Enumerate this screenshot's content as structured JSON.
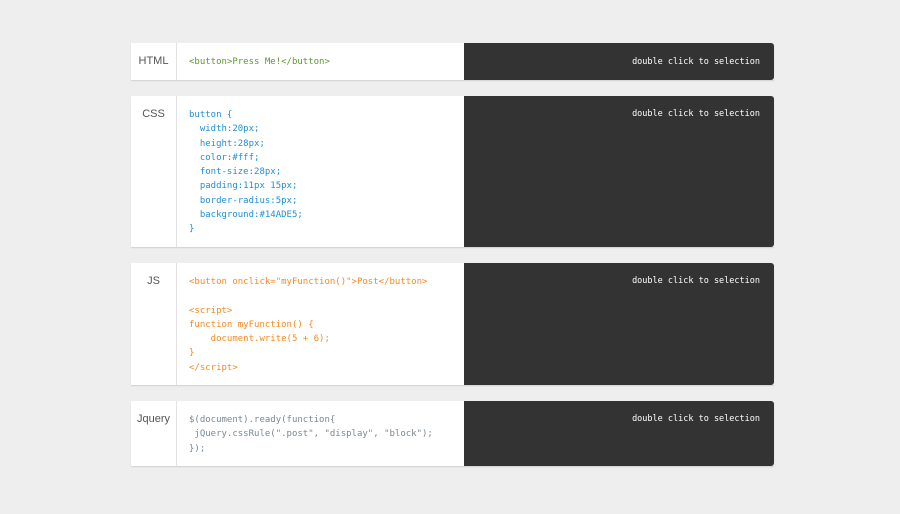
{
  "colors": {
    "html": "#5b9a2e",
    "css": "#1f8fd6",
    "js": "#f5891f",
    "jquery": "#7a8894",
    "panel": "#333333"
  },
  "blocks": [
    {
      "label": "HTML",
      "lang": "html",
      "lines": [
        "<button>Press Me!</button>"
      ],
      "hint": "double click to selection"
    },
    {
      "label": "CSS",
      "lang": "css",
      "lines": [
        "button {",
        "  width:20px;",
        "  height:28px;",
        "  color:#fff;",
        "  font-size:28px;",
        "  padding:11px 15px;",
        "  border-radius:5px;",
        "  background:#14ADE5;",
        "}"
      ],
      "hint": "double click to selection"
    },
    {
      "label": "JS",
      "lang": "js",
      "lines": [
        "<button onclick=\"myFunction()\">Post</button>",
        "",
        "<script>",
        "function myFunction() {",
        "    document.write(5 + 6);",
        "}",
        "</script>"
      ],
      "hint": "double click to selection"
    },
    {
      "label": "Jquery",
      "lang": "jquery",
      "lines": [
        "$(document).ready(function{",
        " jQuery.cssRule(\".post\", \"display\", \"block\");",
        "});"
      ],
      "hint": "double click to selection"
    }
  ]
}
